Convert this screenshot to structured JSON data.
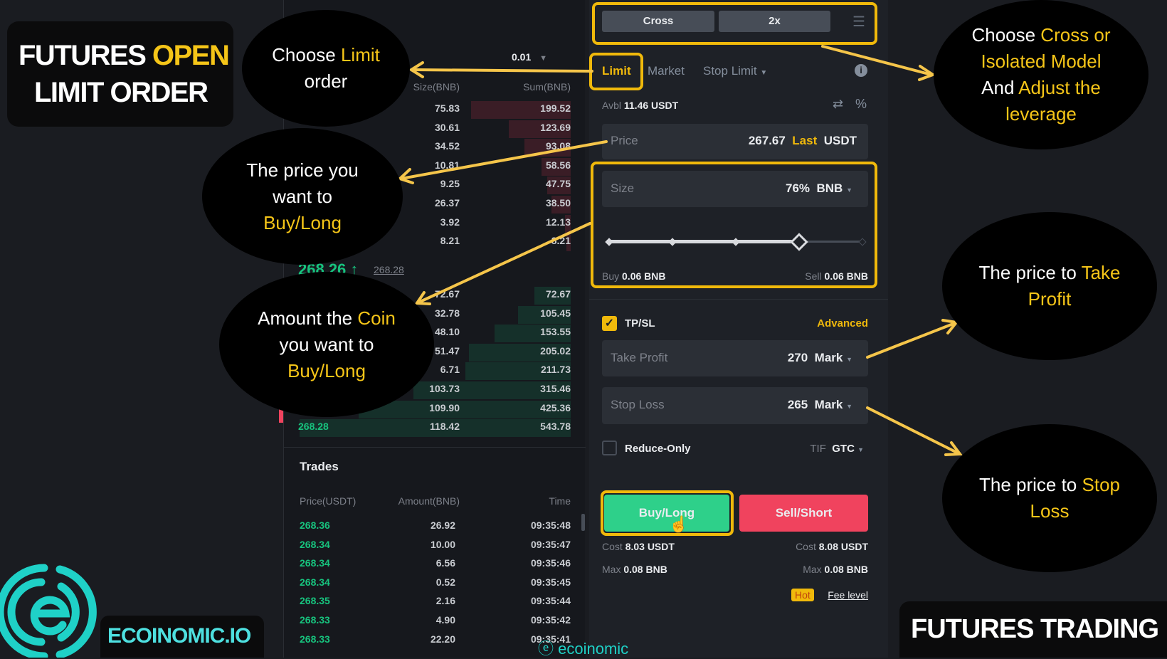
{
  "title_badge": {
    "line1_a": "FUTURES ",
    "line1_b": "OPEN",
    "line2": "LIMIT ORDER"
  },
  "brand": {
    "name": "ECOINOMIC.IO",
    "footer": "FUTURES TRADING",
    "watermark": "ecoinomic",
    "color": "#1fd1c7"
  },
  "colors": {
    "accent": "#f0b90b",
    "buy": "#2ed08a",
    "sell": "#f0435e",
    "up": "#17c37e"
  },
  "orderbook": {
    "precision": "0.01",
    "headers": {
      "size": "Size(BNB)",
      "sum": "Sum(BNB)"
    },
    "asks": [
      {
        "size": "75.83",
        "sum": "199.52"
      },
      {
        "size": "30.61",
        "sum": "123.69"
      },
      {
        "size": "34.52",
        "sum": "93.08"
      },
      {
        "size": "10.81",
        "sum": "58.56"
      },
      {
        "size": "9.25",
        "sum": "47.75"
      },
      {
        "size": "26.37",
        "sum": "38.50"
      },
      {
        "size": "3.92",
        "sum": "12.13"
      },
      {
        "size": "8.21",
        "sum": "8.21"
      }
    ],
    "mid_price": "268.26",
    "mark_price": "268.28",
    "bids": [
      {
        "price": "",
        "size": "72.67",
        "sum": "72.67"
      },
      {
        "price": "",
        "size": "32.78",
        "sum": "105.45"
      },
      {
        "price": "",
        "size": "48.10",
        "sum": "153.55"
      },
      {
        "price": "",
        "size": "51.47",
        "sum": "205.02"
      },
      {
        "price": "",
        "size": "6.71",
        "sum": "211.73"
      },
      {
        "price": "",
        "size": "103.73",
        "sum": "315.46"
      },
      {
        "price": "",
        "size": "109.90",
        "sum": "425.36"
      },
      {
        "price": "268.28",
        "size": "118.42",
        "sum": "543.78"
      }
    ]
  },
  "trades": {
    "title": "Trades",
    "headers": {
      "price": "Price(USDT)",
      "amount": "Amount(BNB)",
      "time": "Time"
    },
    "rows": [
      {
        "price": "268.36",
        "amount": "26.92",
        "time": "09:35:48"
      },
      {
        "price": "268.34",
        "amount": "10.00",
        "time": "09:35:47"
      },
      {
        "price": "268.34",
        "amount": "6.56",
        "time": "09:35:46"
      },
      {
        "price": "268.34",
        "amount": "0.52",
        "time": "09:35:45"
      },
      {
        "price": "268.35",
        "amount": "2.16",
        "time": "09:35:44"
      },
      {
        "price": "268.33",
        "amount": "4.90",
        "time": "09:35:42"
      },
      {
        "price": "268.33",
        "amount": "22.20",
        "time": "09:35:41"
      }
    ]
  },
  "order": {
    "margin_mode": "Cross",
    "leverage": "2x",
    "tabs": [
      "Limit",
      "Market",
      "Stop Limit"
    ],
    "active_tab": "Limit",
    "avbl_label": "Avbl",
    "avbl_value": "11.46 USDT",
    "price": {
      "label": "Price",
      "value": "267.67",
      "ref": "Last",
      "unit": "USDT"
    },
    "size": {
      "label": "Size",
      "value": "76%",
      "unit": "BNB",
      "slider_percent": 76
    },
    "buy_qty_label": "Buy",
    "buy_qty": "0.06 BNB",
    "sell_qty_label": "Sell",
    "sell_qty": "0.06 BNB",
    "tpsl": {
      "label": "TP/SL",
      "checked": true,
      "advanced": "Advanced"
    },
    "take_profit": {
      "label": "Take Profit",
      "value": "270",
      "ref": "Mark"
    },
    "stop_loss": {
      "label": "Stop Loss",
      "value": "265",
      "ref": "Mark"
    },
    "reduce_only": {
      "label": "Reduce-Only",
      "checked": false
    },
    "tif": {
      "label": "TIF",
      "value": "GTC"
    },
    "buy_button": "Buy/Long",
    "sell_button": "Sell/Short",
    "cost_label": "Cost",
    "buy_cost": "8.03 USDT",
    "sell_cost": "8.08 USDT",
    "max_label": "Max",
    "buy_max": "0.08 BNB",
    "sell_max": "0.08 BNB",
    "hot": "Hot",
    "fee_level": "Fee level"
  },
  "annotations": {
    "limit": {
      "a": "Choose ",
      "b": "Limit",
      "c": "order"
    },
    "price": {
      "a": "The price you",
      "b": "want to",
      "c": "Buy/Long"
    },
    "amount": {
      "a": "Amount the ",
      "b": "Coin",
      "c": "you want to",
      "d": "Buy/Long"
    },
    "cross": {
      "a": "Choose ",
      "b": "Cross or",
      "c": "Isolated Model",
      "d": "And ",
      "e": "Adjust the",
      "f": "leverage"
    },
    "tp": {
      "a": "The price to ",
      "b": "Take",
      "c": "Profit"
    },
    "sl": {
      "a": "The price to ",
      "b": "Stop",
      "c": "Loss"
    }
  }
}
